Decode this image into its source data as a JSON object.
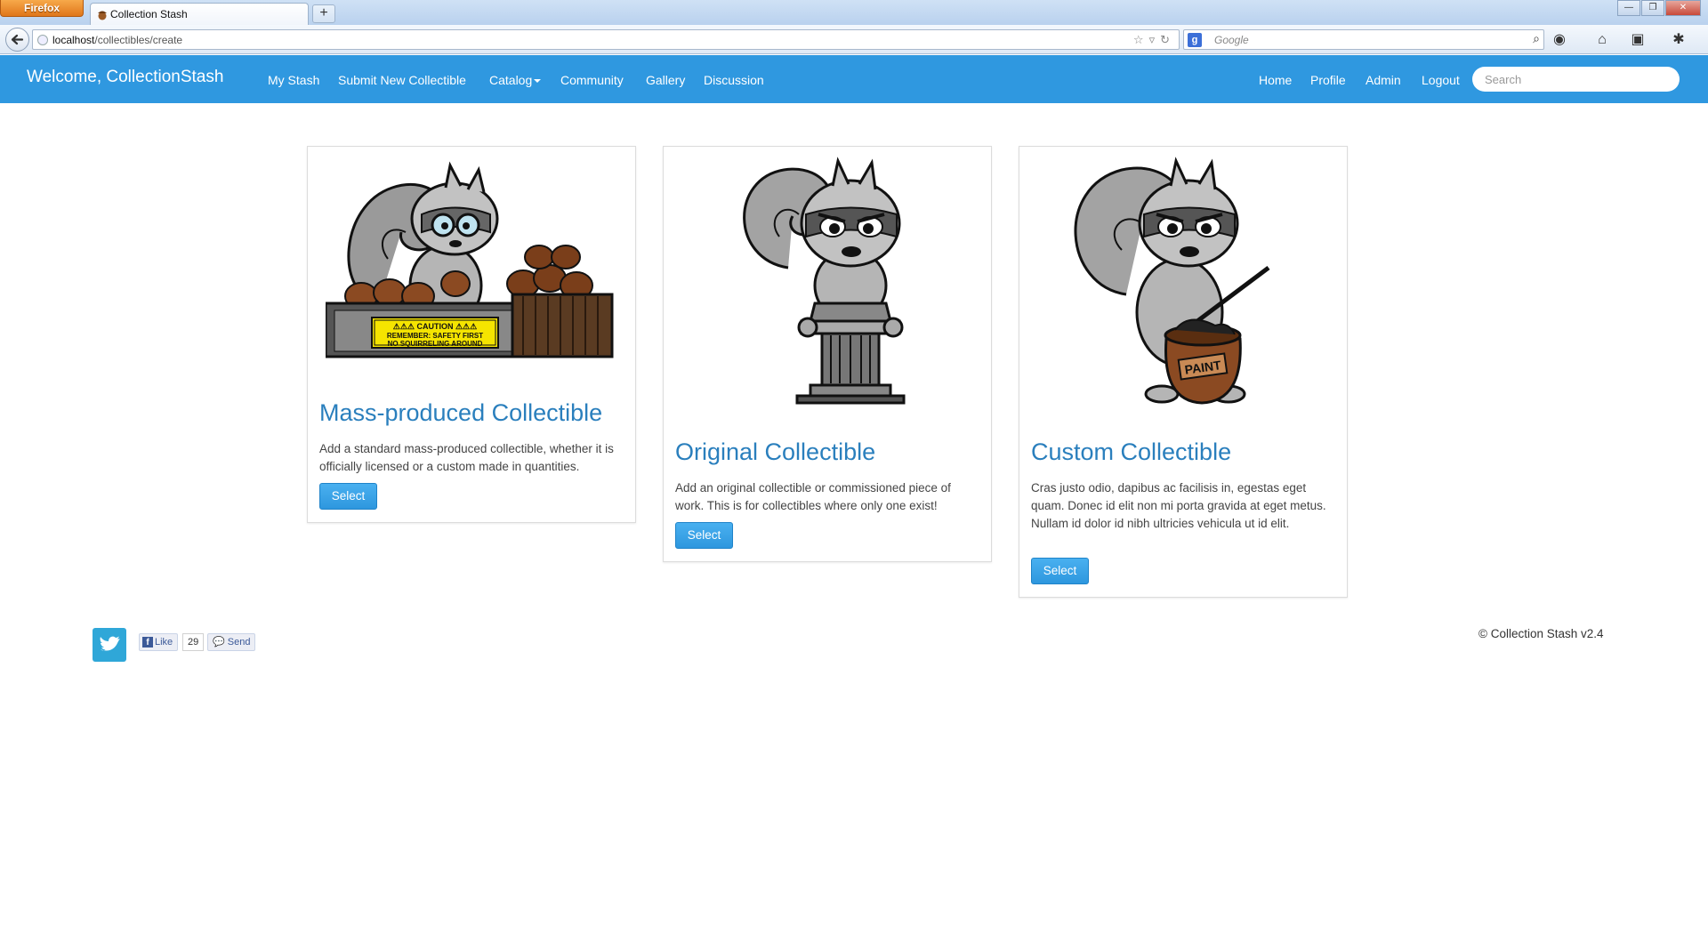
{
  "browser": {
    "menu_button": "Firefox",
    "tab_title": "Collection Stash",
    "new_tab": "+",
    "url_host": "localhost",
    "url_path": "/collectibles/create",
    "search_placeholder": "Google",
    "search_engine_letter": "g"
  },
  "site_nav": {
    "brand": "Welcome, CollectionStash",
    "left_links": [
      "My Stash",
      "Submit New Collectible",
      "Catalog",
      "Community",
      "Gallery",
      "Discussion"
    ],
    "right_links": [
      "Home",
      "Profile",
      "Admin",
      "Logout"
    ],
    "search_placeholder": "Search"
  },
  "cards": [
    {
      "title": "Mass-produced Collectible",
      "description": "Add a standard mass-produced collectible, whether it is officially licensed or a custom made in quantities.",
      "button": "Select",
      "image_caption": [
        "⚠⚠⚠ CAUTION ⚠⚠⚠",
        "REMEMBER: SAFETY FIRST",
        "NO SQUIRRELING AROUND"
      ]
    },
    {
      "title": "Original Collectible",
      "description": "Add an original collectible or commissioned piece of work. This is for collectibles where only one exist!",
      "button": "Select"
    },
    {
      "title": "Custom Collectible",
      "description": "Cras justo odio, dapibus ac facilisis in, egestas eget quam. Donec id elit non mi porta gravida at eget metus. Nullam id dolor id nibh ultricies vehicula ut id elit.",
      "button": "Select",
      "image_caption": [
        "PAINT"
      ]
    }
  ],
  "footer": {
    "fb_like": "Like",
    "fb_count": "29",
    "fb_send": "Send",
    "copyright": "© Collection Stash v2.4"
  },
  "colors": {
    "nav_bg": "#2f98e0",
    "title_blue": "#2a7fbd",
    "button_blue": "#3aa3e8"
  }
}
